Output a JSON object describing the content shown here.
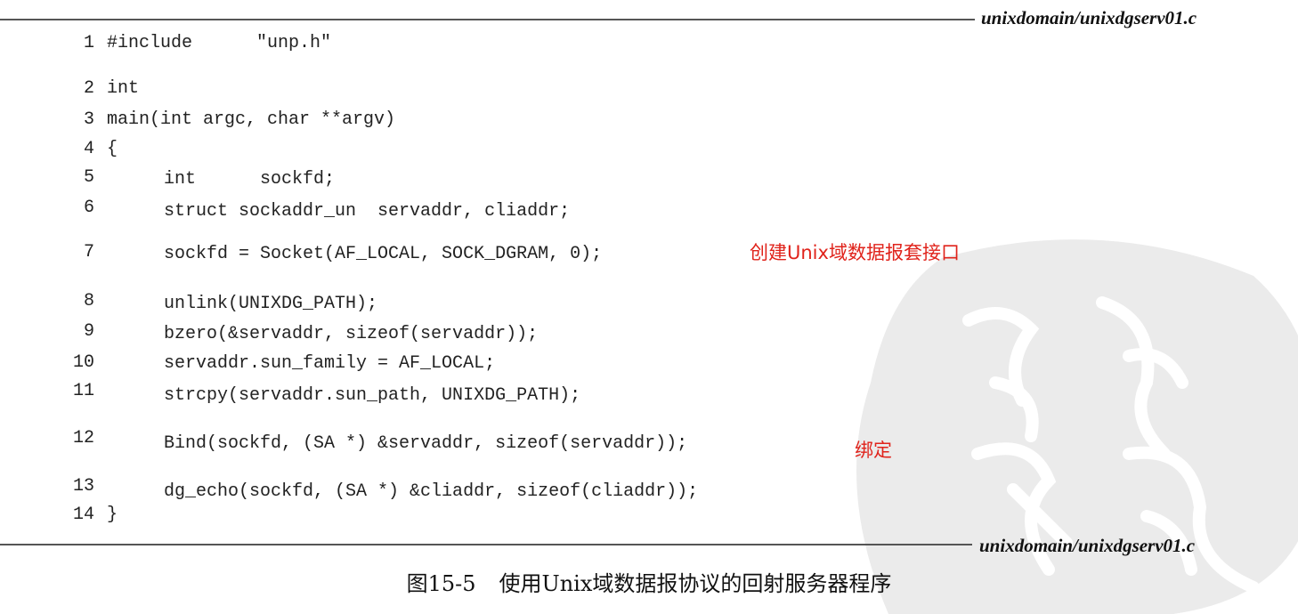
{
  "header": {
    "filename": "unixdomain/unixdgserv01.c"
  },
  "footer": {
    "filename": "unixdomain/unixdgserv01.c"
  },
  "code_lines": [
    {
      "num": "1",
      "text": "#include      \"unp.h\""
    },
    {
      "num": "2",
      "text": "int"
    },
    {
      "num": "3",
      "text": "main(int argc, char **argv)"
    },
    {
      "num": "4",
      "text": "{"
    },
    {
      "num": "5",
      "text": "    int      sockfd;"
    },
    {
      "num": "6",
      "text": "    struct sockaddr_un  servaddr, cliaddr;"
    },
    {
      "num": "7",
      "text": "    sockfd = Socket(AF_LOCAL, SOCK_DGRAM, 0);"
    },
    {
      "num": "8",
      "text": "    unlink(UNIXDG_PATH);"
    },
    {
      "num": "9",
      "text": "    bzero(&servaddr, sizeof(servaddr));"
    },
    {
      "num": "10",
      "text": "    servaddr.sun_family = AF_LOCAL;"
    },
    {
      "num": "11",
      "text": "    strcpy(servaddr.sun_path, UNIXDG_PATH);"
    },
    {
      "num": "12",
      "text": "    Bind(sockfd, (SA *) &servaddr, sizeof(servaddr));"
    },
    {
      "num": "13",
      "text": "    dg_echo(sockfd, (SA *) &cliaddr, sizeof(cliaddr));"
    },
    {
      "num": "14",
      "text": "}"
    }
  ],
  "annotations": [
    {
      "line": "7",
      "text": "创建Unix域数据报套接口"
    },
    {
      "line": "12",
      "text": "绑定"
    }
  ],
  "caption": {
    "figure": "图15-5",
    "title": "使用Unix域数据报协议的回射服务器程序"
  },
  "colors": {
    "annotation": "#e0231b",
    "text": "#222222",
    "watermark": "#e9e9e9"
  }
}
